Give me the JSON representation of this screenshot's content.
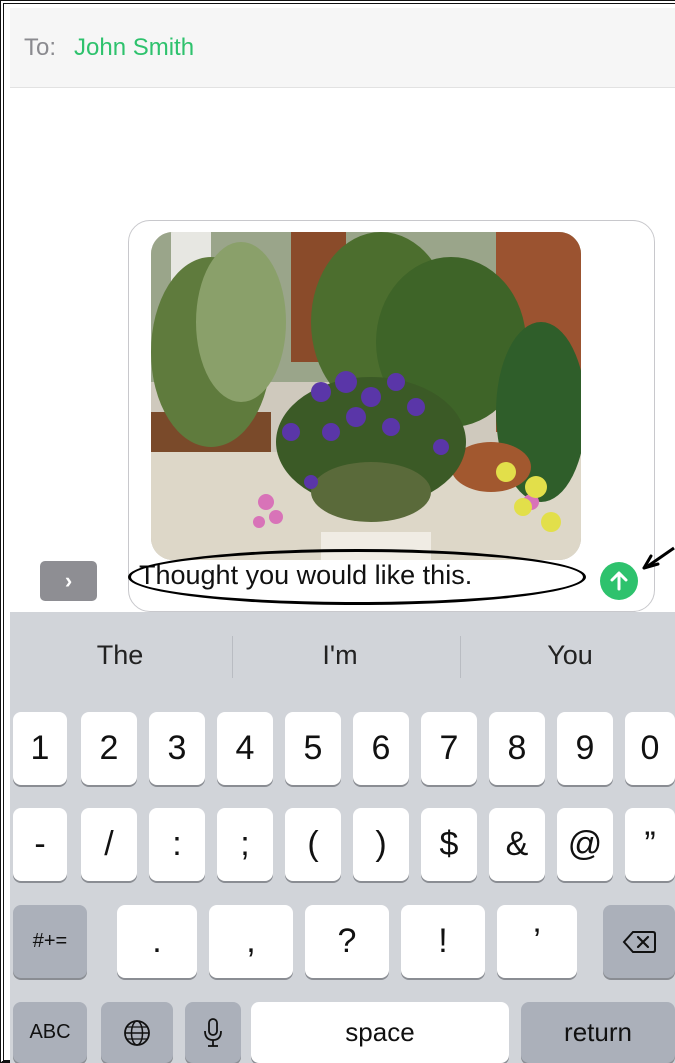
{
  "header": {
    "to_label": "To:",
    "recipient": "John Smith"
  },
  "compose": {
    "expand_icon": "chevron-right-icon",
    "message_text": "Thought you would like this.",
    "send_icon": "arrow-up-icon"
  },
  "keyboard": {
    "suggestions": [
      "The",
      "I'm",
      "You"
    ],
    "row1": [
      "1",
      "2",
      "3",
      "4",
      "5",
      "6",
      "7",
      "8",
      "9",
      "0"
    ],
    "row2": [
      "-",
      "/",
      ":",
      ";",
      "(",
      ")",
      "$",
      "&",
      "@",
      "”"
    ],
    "row3": {
      "symbols_label": "#+=",
      "keys": [
        ".",
        ",",
        "?",
        "!",
        "’"
      ],
      "delete_icon": "backspace-icon"
    },
    "row4": {
      "abc_label": "ABC",
      "globe_icon": "globe-icon",
      "mic_icon": "microphone-icon",
      "space_label": "space",
      "return_label": "return"
    }
  },
  "colors": {
    "accent_green": "#2ec26d",
    "keyboard_bg": "#d1d4d9",
    "dark_key": "#abb0ba"
  }
}
